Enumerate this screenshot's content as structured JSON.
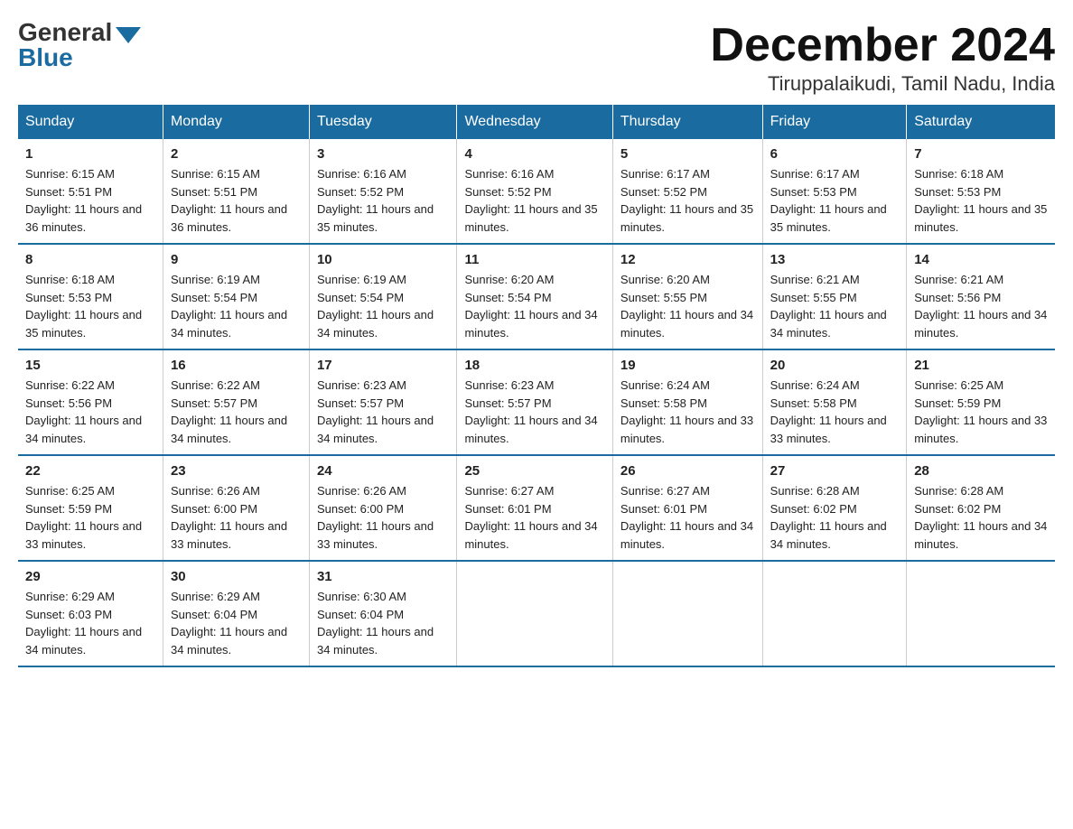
{
  "logo": {
    "general": "General",
    "blue": "Blue"
  },
  "header": {
    "month": "December 2024",
    "location": "Tiruppalaikudi, Tamil Nadu, India"
  },
  "days_header": [
    "Sunday",
    "Monday",
    "Tuesday",
    "Wednesday",
    "Thursday",
    "Friday",
    "Saturday"
  ],
  "weeks": [
    [
      {
        "num": "1",
        "sunrise": "6:15 AM",
        "sunset": "5:51 PM",
        "daylight": "11 hours and 36 minutes."
      },
      {
        "num": "2",
        "sunrise": "6:15 AM",
        "sunset": "5:51 PM",
        "daylight": "11 hours and 36 minutes."
      },
      {
        "num": "3",
        "sunrise": "6:16 AM",
        "sunset": "5:52 PM",
        "daylight": "11 hours and 35 minutes."
      },
      {
        "num": "4",
        "sunrise": "6:16 AM",
        "sunset": "5:52 PM",
        "daylight": "11 hours and 35 minutes."
      },
      {
        "num": "5",
        "sunrise": "6:17 AM",
        "sunset": "5:52 PM",
        "daylight": "11 hours and 35 minutes."
      },
      {
        "num": "6",
        "sunrise": "6:17 AM",
        "sunset": "5:53 PM",
        "daylight": "11 hours and 35 minutes."
      },
      {
        "num": "7",
        "sunrise": "6:18 AM",
        "sunset": "5:53 PM",
        "daylight": "11 hours and 35 minutes."
      }
    ],
    [
      {
        "num": "8",
        "sunrise": "6:18 AM",
        "sunset": "5:53 PM",
        "daylight": "11 hours and 35 minutes."
      },
      {
        "num": "9",
        "sunrise": "6:19 AM",
        "sunset": "5:54 PM",
        "daylight": "11 hours and 34 minutes."
      },
      {
        "num": "10",
        "sunrise": "6:19 AM",
        "sunset": "5:54 PM",
        "daylight": "11 hours and 34 minutes."
      },
      {
        "num": "11",
        "sunrise": "6:20 AM",
        "sunset": "5:54 PM",
        "daylight": "11 hours and 34 minutes."
      },
      {
        "num": "12",
        "sunrise": "6:20 AM",
        "sunset": "5:55 PM",
        "daylight": "11 hours and 34 minutes."
      },
      {
        "num": "13",
        "sunrise": "6:21 AM",
        "sunset": "5:55 PM",
        "daylight": "11 hours and 34 minutes."
      },
      {
        "num": "14",
        "sunrise": "6:21 AM",
        "sunset": "5:56 PM",
        "daylight": "11 hours and 34 minutes."
      }
    ],
    [
      {
        "num": "15",
        "sunrise": "6:22 AM",
        "sunset": "5:56 PM",
        "daylight": "11 hours and 34 minutes."
      },
      {
        "num": "16",
        "sunrise": "6:22 AM",
        "sunset": "5:57 PM",
        "daylight": "11 hours and 34 minutes."
      },
      {
        "num": "17",
        "sunrise": "6:23 AM",
        "sunset": "5:57 PM",
        "daylight": "11 hours and 34 minutes."
      },
      {
        "num": "18",
        "sunrise": "6:23 AM",
        "sunset": "5:57 PM",
        "daylight": "11 hours and 34 minutes."
      },
      {
        "num": "19",
        "sunrise": "6:24 AM",
        "sunset": "5:58 PM",
        "daylight": "11 hours and 33 minutes."
      },
      {
        "num": "20",
        "sunrise": "6:24 AM",
        "sunset": "5:58 PM",
        "daylight": "11 hours and 33 minutes."
      },
      {
        "num": "21",
        "sunrise": "6:25 AM",
        "sunset": "5:59 PM",
        "daylight": "11 hours and 33 minutes."
      }
    ],
    [
      {
        "num": "22",
        "sunrise": "6:25 AM",
        "sunset": "5:59 PM",
        "daylight": "11 hours and 33 minutes."
      },
      {
        "num": "23",
        "sunrise": "6:26 AM",
        "sunset": "6:00 PM",
        "daylight": "11 hours and 33 minutes."
      },
      {
        "num": "24",
        "sunrise": "6:26 AM",
        "sunset": "6:00 PM",
        "daylight": "11 hours and 33 minutes."
      },
      {
        "num": "25",
        "sunrise": "6:27 AM",
        "sunset": "6:01 PM",
        "daylight": "11 hours and 34 minutes."
      },
      {
        "num": "26",
        "sunrise": "6:27 AM",
        "sunset": "6:01 PM",
        "daylight": "11 hours and 34 minutes."
      },
      {
        "num": "27",
        "sunrise": "6:28 AM",
        "sunset": "6:02 PM",
        "daylight": "11 hours and 34 minutes."
      },
      {
        "num": "28",
        "sunrise": "6:28 AM",
        "sunset": "6:02 PM",
        "daylight": "11 hours and 34 minutes."
      }
    ],
    [
      {
        "num": "29",
        "sunrise": "6:29 AM",
        "sunset": "6:03 PM",
        "daylight": "11 hours and 34 minutes."
      },
      {
        "num": "30",
        "sunrise": "6:29 AM",
        "sunset": "6:04 PM",
        "daylight": "11 hours and 34 minutes."
      },
      {
        "num": "31",
        "sunrise": "6:30 AM",
        "sunset": "6:04 PM",
        "daylight": "11 hours and 34 minutes."
      },
      null,
      null,
      null,
      null
    ]
  ],
  "labels": {
    "sunrise": "Sunrise:",
    "sunset": "Sunset:",
    "daylight": "Daylight:"
  }
}
